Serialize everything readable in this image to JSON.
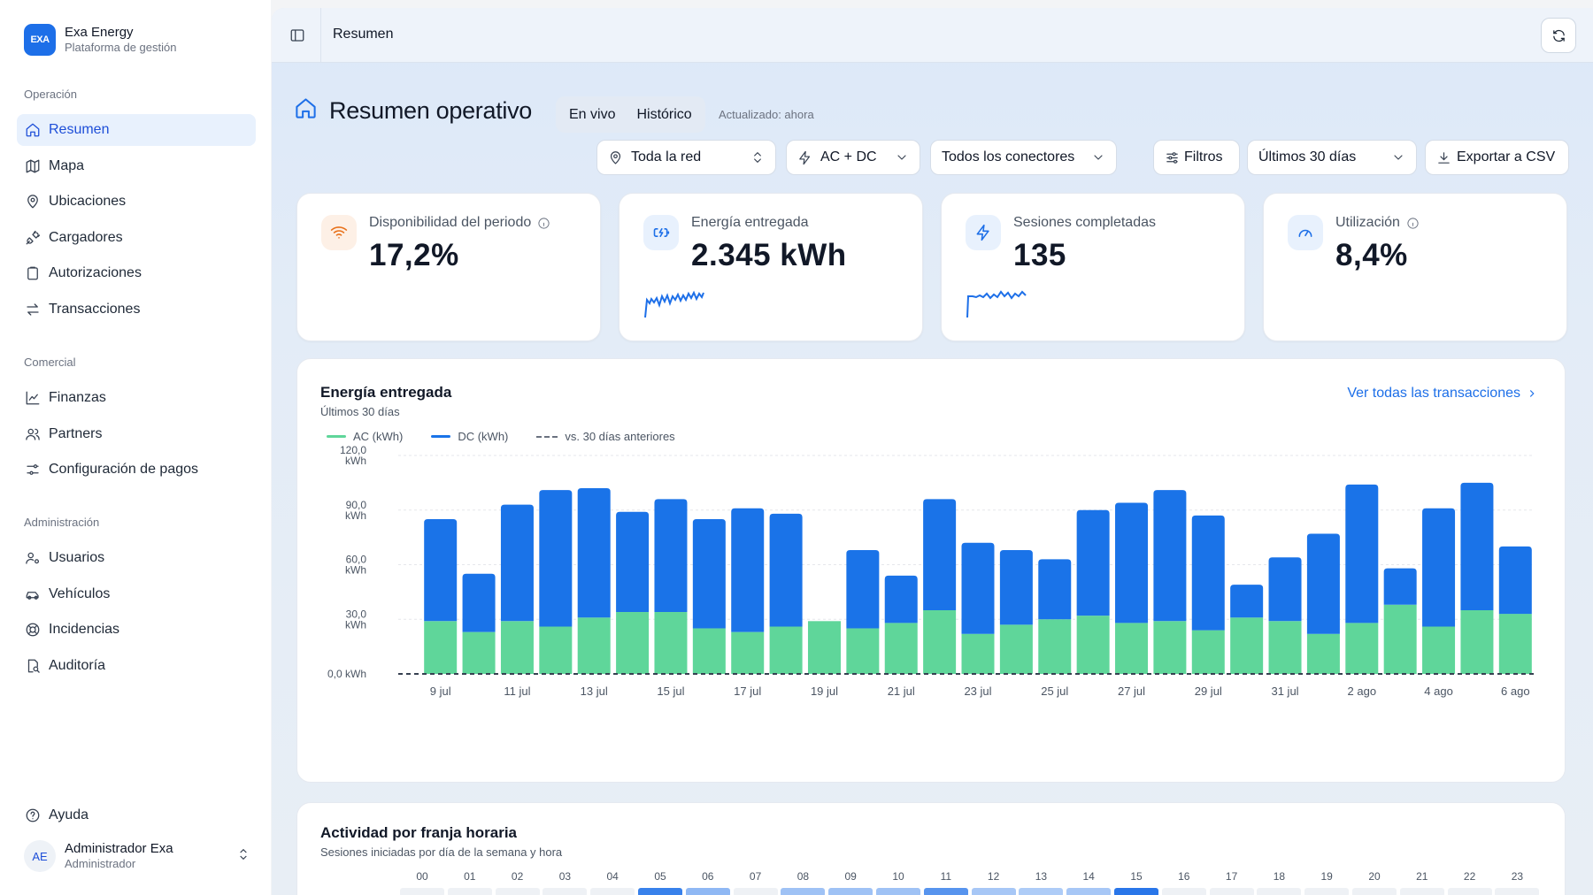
{
  "brand": {
    "logo_text": "EXA",
    "name": "Exa Energy",
    "subtitle": "Plataforma de gestión"
  },
  "sidebar": {
    "sections": [
      {
        "title": "Operación",
        "items": [
          {
            "label": "Resumen",
            "icon": "home-icon",
            "active": true
          },
          {
            "label": "Mapa",
            "icon": "map-icon"
          },
          {
            "label": "Ubicaciones",
            "icon": "location-pin-icon"
          },
          {
            "label": "Cargadores",
            "icon": "plug-icon"
          },
          {
            "label": "Autorizaciones",
            "icon": "clipboard-icon"
          },
          {
            "label": "Transacciones",
            "icon": "arrows-swap-icon"
          }
        ]
      },
      {
        "title": "Comercial",
        "items": [
          {
            "label": "Finanzas",
            "icon": "line-chart-icon"
          },
          {
            "label": "Partners",
            "icon": "users-icon"
          },
          {
            "label": "Configuración de pagos",
            "icon": "sliders-icon"
          }
        ]
      },
      {
        "title": "Administración",
        "items": [
          {
            "label": "Usuarios",
            "icon": "user-cog-icon"
          },
          {
            "label": "Vehículos",
            "icon": "car-icon"
          },
          {
            "label": "Incidencias",
            "icon": "lifebuoy-icon"
          },
          {
            "label": "Auditoría",
            "icon": "audit-icon"
          }
        ]
      }
    ],
    "help_label": "Ayuda",
    "user": {
      "initials": "AE",
      "name": "Administrador Exa",
      "role": "Administrador"
    }
  },
  "topbar": {
    "title": "Resumen"
  },
  "page": {
    "title": "Resumen operativo",
    "modes": [
      "En vivo",
      "Histórico"
    ],
    "selected_mode": "Histórico",
    "updated": "Actualizado: ahora"
  },
  "filters": {
    "network": "Toda la red",
    "current_type": "AC + DC",
    "connectors": "Todos los conectores",
    "filters_label": "Filtros",
    "period": "Últimos 30 días",
    "export_label": "Exportar a CSV"
  },
  "kpis": [
    {
      "label": "Disponibilidad del periodo",
      "value": "17,2%",
      "icon": "wifi-icon",
      "info": true
    },
    {
      "label": "Energía entregada",
      "value": "2.345 kWh",
      "icon": "battery-charging-icon",
      "info": false
    },
    {
      "label": "Sesiones completadas",
      "value": "135",
      "icon": "bolt-icon",
      "info": false
    },
    {
      "label": "Utilización",
      "value": "8,4%",
      "icon": "gauge-icon",
      "info": true
    }
  ],
  "colors": {
    "accent": "#1d6fe8",
    "ac": "#5fd69a",
    "dc": "#1a73e8",
    "orange": "#e8711a"
  },
  "energy_card": {
    "title": "Energía entregada",
    "subtitle": "Últimos 30 días",
    "link": "Ver todas las transacciones",
    "legend": [
      "AC (kWh)",
      "DC (kWh)",
      "vs. 30 días anteriores"
    ]
  },
  "chart_data": {
    "type": "bar",
    "stacked": true,
    "categories": [
      "9 jul",
      "10 jul",
      "11 jul",
      "12 jul",
      "13 jul",
      "14 jul",
      "15 jul",
      "16 jul",
      "17 jul",
      "18 jul",
      "19 jul",
      "20 jul",
      "21 jul",
      "22 jul",
      "23 jul",
      "24 jul",
      "25 jul",
      "26 jul",
      "27 jul",
      "28 jul",
      "29 jul",
      "30 jul",
      "31 jul",
      "1 ago",
      "2 ago",
      "3 ago",
      "4 ago",
      "5 ago",
      "6 ago"
    ],
    "tick_labels": [
      "9 jul",
      "11 jul",
      "13 jul",
      "15 jul",
      "17 jul",
      "19 jul",
      "21 jul",
      "23 jul",
      "25 jul",
      "27 jul",
      "29 jul",
      "31 jul",
      "2 ago",
      "4 ago",
      "6 ago"
    ],
    "y_ticks": [
      "0,0 kWh",
      "30,0 kWh",
      "60,0 kWh",
      "90,0 kWh",
      "120,0 kWh"
    ],
    "ylim": [
      0,
      120
    ],
    "grid": true,
    "series": [
      {
        "name": "AC (kWh)",
        "values": [
          29,
          23,
          29,
          26,
          31,
          34,
          34,
          25,
          23,
          26,
          29,
          25,
          28,
          35,
          22,
          27,
          30,
          32,
          28,
          29,
          24,
          31,
          29,
          22,
          28,
          38,
          26,
          35,
          33
        ]
      },
      {
        "name": "DC (kWh)",
        "values": [
          56,
          32,
          64,
          75,
          71,
          55,
          62,
          60,
          68,
          62,
          0,
          43,
          26,
          61,
          50,
          41,
          33,
          58,
          66,
          72,
          63,
          18,
          35,
          55,
          76,
          20,
          65,
          70,
          37
        ]
      },
      {
        "name": "vs. 30 días anteriores",
        "values": [
          0,
          0,
          0,
          0,
          0,
          0,
          0,
          0,
          0,
          0,
          0,
          0,
          0,
          0,
          0,
          0,
          0,
          0,
          0,
          0,
          0,
          0,
          0,
          0,
          0,
          0,
          0,
          0,
          0
        ]
      }
    ]
  },
  "activity_card": {
    "title": "Actividad por franja horaria",
    "subtitle": "Sesiones iniciadas por día de la semana y hora",
    "hours": [
      "00",
      "01",
      "02",
      "03",
      "04",
      "05",
      "06",
      "07",
      "08",
      "09",
      "10",
      "11",
      "12",
      "13",
      "14",
      "15",
      "16",
      "17",
      "18",
      "19",
      "20",
      "21",
      "22",
      "23"
    ],
    "first_row_intensity": [
      0.05,
      0.05,
      0.05,
      0.05,
      0.05,
      0.9,
      0.35,
      0.08,
      0.25,
      0.25,
      0.25,
      0.7,
      0.2,
      0.15,
      0.2,
      1.0,
      0.05,
      0.05,
      0.05,
      0.05,
      0.05,
      0.05,
      0.05,
      0.05
    ]
  }
}
